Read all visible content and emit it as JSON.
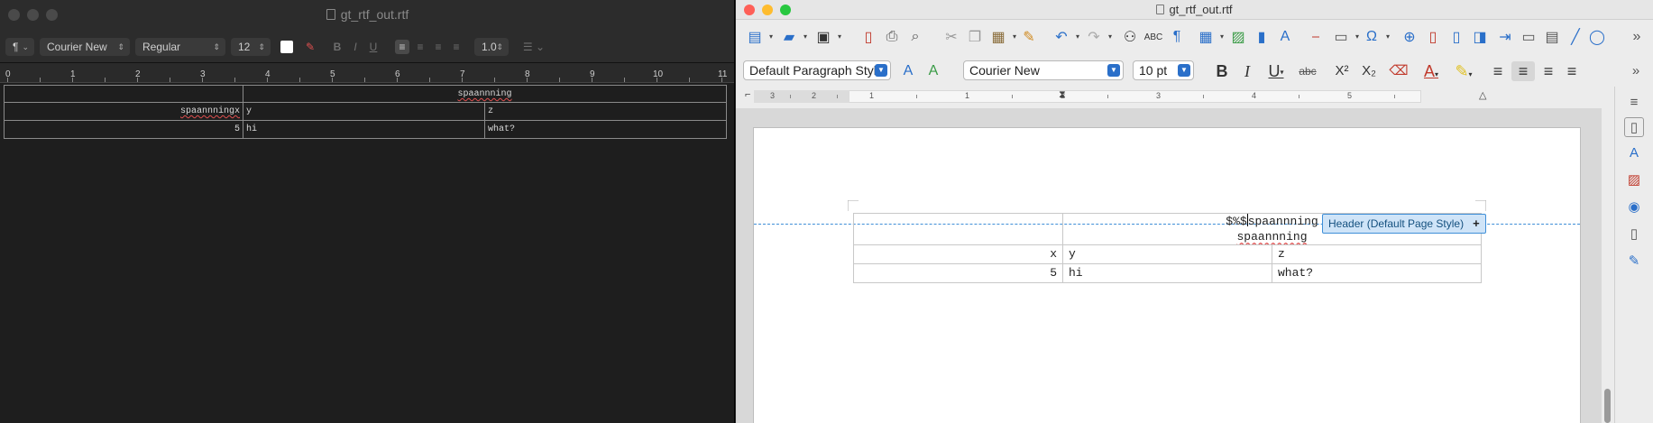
{
  "left_window": {
    "title": "gt_rtf_out.rtf",
    "toolbar": {
      "paragraph_style": "¶",
      "font_family": "Courier New",
      "font_style": "Regular",
      "font_size": "12",
      "line_spacing": "1.0",
      "bold": "B",
      "italic": "I",
      "underline": "U"
    },
    "ruler_numbers": [
      "0",
      "1",
      "2",
      "3",
      "4",
      "5",
      "6",
      "7",
      "8",
      "9",
      "10",
      "11"
    ],
    "table": {
      "spanner_row": [
        "",
        "spaannning"
      ],
      "header_row": [
        "spaannningx",
        "y",
        "z"
      ],
      "data_row": [
        "5",
        "hi",
        "what?"
      ]
    }
  },
  "right_window": {
    "title": "gt_rtf_out.rtf",
    "toolbar": {
      "paragraph_style": "Default Paragraph Style",
      "font_name": "Courier New",
      "font_size": "10 pt"
    },
    "ruler_numbers": [
      "3",
      "2",
      "1",
      "1",
      "2",
      "3",
      "4",
      "5"
    ],
    "header_tag": {
      "label": "Header (Default Page Style)",
      "plus": "+"
    },
    "table": {
      "header_prefix": "$%$",
      "header_text": "spaannning",
      "spanner_row": [
        "",
        "spaannning"
      ],
      "header_row": [
        "x",
        "y",
        "z"
      ],
      "data_row": [
        "5",
        "hi",
        "what?"
      ]
    }
  },
  "colors": {
    "close": "#fe5f57",
    "minimize": "#febc2e",
    "zoom": "#28c840",
    "accent": "#2a6fc9",
    "header_blue": "#3f8fd8"
  }
}
